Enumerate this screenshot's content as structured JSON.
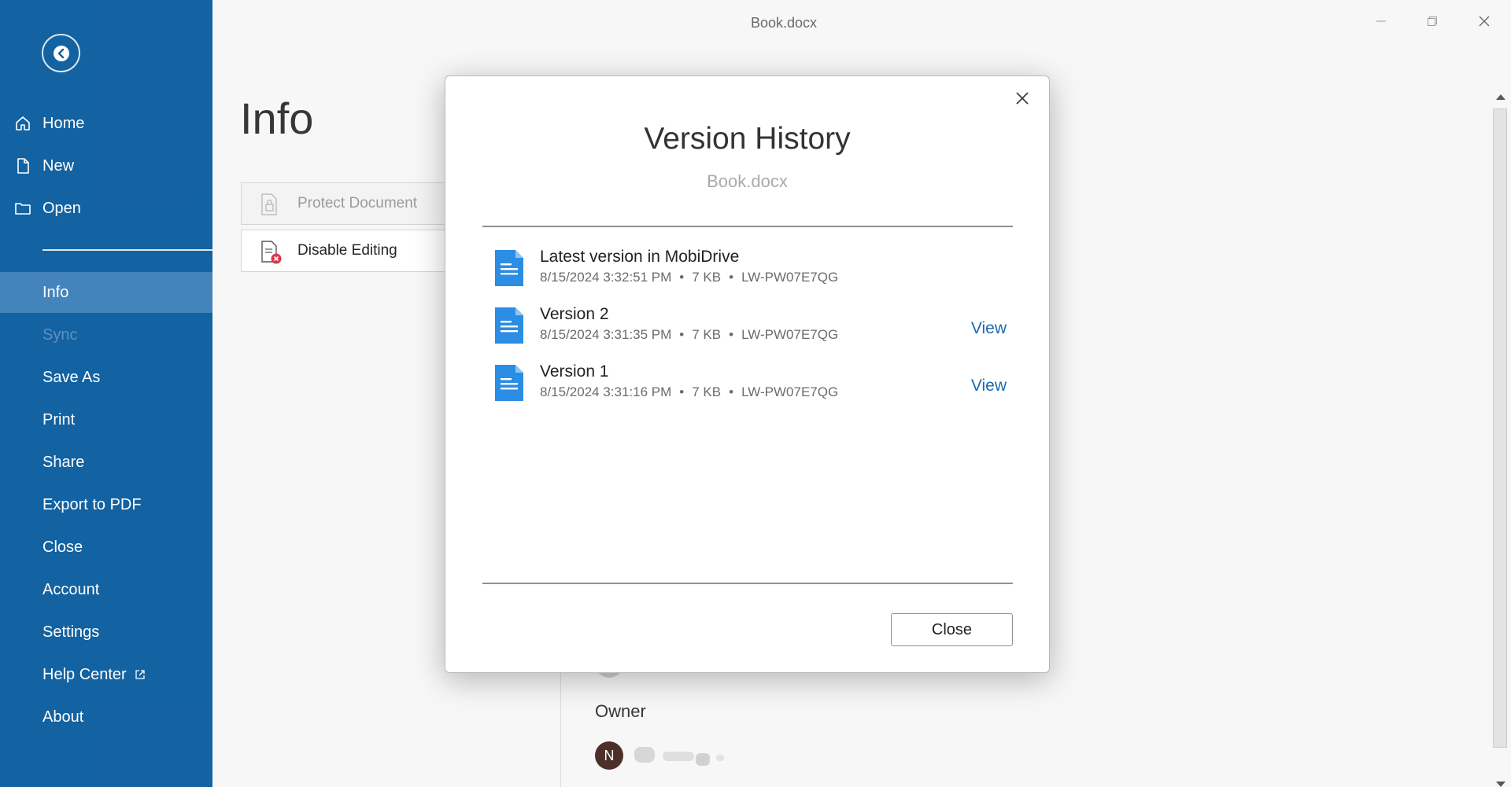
{
  "window": {
    "title": "Book.docx",
    "controls": [
      "minimize-icon",
      "restore-icon",
      "close-icon"
    ]
  },
  "sidebar": {
    "back_icon": "arrow-left-icon",
    "items": [
      {
        "label": "Home",
        "icon": "home-icon"
      },
      {
        "label": "New",
        "icon": "new-file-icon"
      },
      {
        "label": "Open",
        "icon": "folder-icon"
      },
      {
        "label": "Info",
        "active": true
      },
      {
        "label": "Sync",
        "disabled": true
      },
      {
        "label": "Save As"
      },
      {
        "label": "Print"
      },
      {
        "label": "Share"
      },
      {
        "label": "Export to PDF"
      },
      {
        "label": "Close"
      },
      {
        "label": "Account"
      },
      {
        "label": "Settings"
      },
      {
        "label": "Help Center",
        "icon": "external-link-icon"
      },
      {
        "label": "About"
      }
    ]
  },
  "info_page": {
    "title": "Info",
    "buttons": [
      {
        "label": "Protect Document",
        "icon": "lock-document-icon",
        "disabled": true
      },
      {
        "label": "Disable Editing",
        "icon": "document-disable-icon"
      }
    ],
    "owner_label": "Owner",
    "owner_initial": "N"
  },
  "dialog": {
    "title": "Version History",
    "subtitle": "Book.docx",
    "versions": [
      {
        "name": "Latest version in MobiDrive",
        "date": "8/15/2024 3:32:51 PM",
        "size": "7 KB",
        "device": "LW-PW07E7QG",
        "view_label": ""
      },
      {
        "name": "Version 2",
        "date": "8/15/2024 3:31:35 PM",
        "size": "7 KB",
        "device": "LW-PW07E7QG",
        "view_label": "View"
      },
      {
        "name": "Version 1",
        "date": "8/15/2024 3:31:16 PM",
        "size": "7 KB",
        "device": "LW-PW07E7QG",
        "view_label": "View"
      }
    ],
    "close_button": "Close",
    "separator": "•"
  },
  "colors": {
    "sidebar_bg": "#0f5fa0",
    "sidebar_active": "#3f82ba",
    "link": "#1a6ab0",
    "doc_icon": "#2b8de3"
  }
}
